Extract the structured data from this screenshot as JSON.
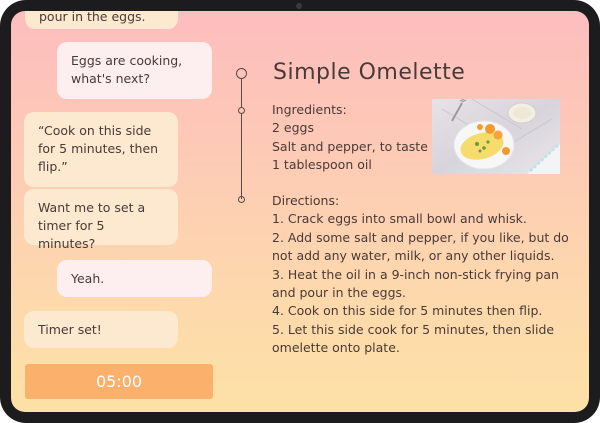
{
  "chat": {
    "messages": [
      {
        "from": "assistant",
        "text": "pour in the eggs."
      },
      {
        "from": "user",
        "text": "Eggs are cooking, what's next?"
      },
      {
        "from": "assistant",
        "text": "“Cook on this side for 5 minutes, then flip.”"
      },
      {
        "from": "assistant",
        "text": "Want me to set a timer for 5 minutes?"
      },
      {
        "from": "user",
        "text": "Yeah."
      },
      {
        "from": "assistant",
        "text": "Timer set!"
      }
    ],
    "timer": "05:00"
  },
  "recipe": {
    "title": "Simple Omelette",
    "ingredients_heading": "Ingredients:",
    "ingredients": [
      "2 eggs",
      "Salt and pepper, to taste",
      "1 tablespoon oil"
    ],
    "directions_heading": "Directions:",
    "directions_lines": [
      "1. Crack eggs into small bowl and whisk.",
      "2. Add some salt and pepper, if you like, but do",
      "not add any water, milk, or any other liquids.",
      "3. Heat the oil in a 9-inch non-stick frying pan",
      "and pour in the eggs.",
      "4. Cook on this side for 5 minutes then flip.",
      "5. Let this side cook for 5 minutes, then slide",
      "omelette onto plate."
    ],
    "photo_icon": "omelette-photo"
  },
  "colors": {
    "timer_button": "#fbb16c",
    "assistant_bubble": "#fde9cf",
    "user_bubble": "#fdeef0"
  }
}
